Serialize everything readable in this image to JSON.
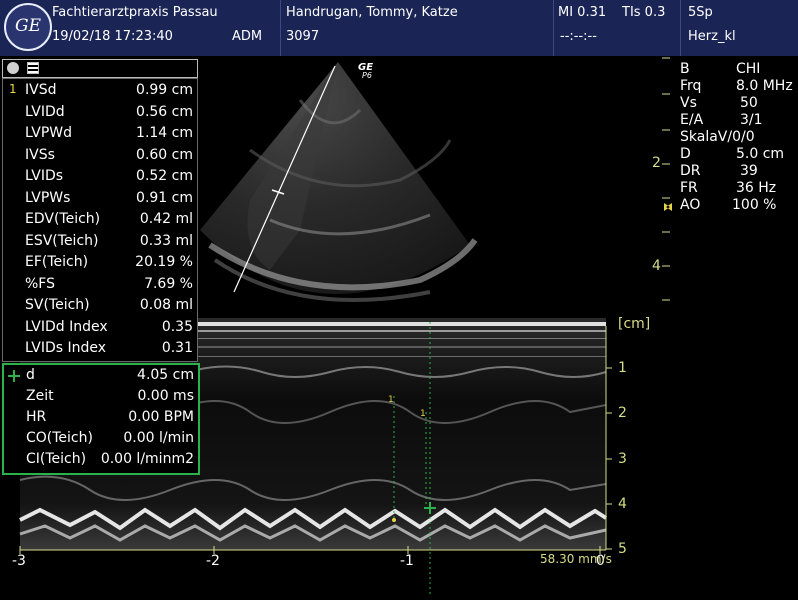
{
  "header": {
    "logo_text": "GE",
    "clinic": "Fachtierarztpraxis Passau",
    "datetime": "19/02/18 17:23:40",
    "operator": "ADM",
    "patient": "Handrugan, Tommy, Katze",
    "patient_id": "3097",
    "mi": "MI 0.31",
    "tis": "TIs 0.3",
    "time_placeholder": "--:--:--",
    "probe": "5Sp",
    "preset": "Herz_kl"
  },
  "probe_marker": {
    "brand": "GE",
    "code": "P6"
  },
  "measurements": [
    {
      "index": "1",
      "label": "IVSd",
      "value": "0.99 cm"
    },
    {
      "index": "",
      "label": "LVIDd",
      "value": "0.56 cm"
    },
    {
      "index": "",
      "label": "LVPWd",
      "value": "1.14 cm"
    },
    {
      "index": "",
      "label": "IVSs",
      "value": "0.60 cm"
    },
    {
      "index": "",
      "label": "LVIDs",
      "value": "0.52 cm"
    },
    {
      "index": "",
      "label": "LVPWs",
      "value": "0.91 cm"
    },
    {
      "index": "",
      "label": "EDV(Teich)",
      "value": "0.42 ml"
    },
    {
      "index": "",
      "label": "ESV(Teich)",
      "value": "0.33 ml"
    },
    {
      "index": "",
      "label": "EF(Teich)",
      "value": "20.19 %"
    },
    {
      "index": "",
      "label": "%FS",
      "value": "7.69 %"
    },
    {
      "index": "",
      "label": "SV(Teich)",
      "value": "0.08 ml"
    },
    {
      "index": "",
      "label": "LVIDd Index",
      "value": "0.35"
    },
    {
      "index": "",
      "label": "LVIDs Index",
      "value": "0.31"
    }
  ],
  "caliper_panel": [
    {
      "label": "d",
      "value": "4.05 cm"
    },
    {
      "label": "Zeit",
      "value": "0.00 ms"
    },
    {
      "label": "HR",
      "value": "0.00 BPM"
    },
    {
      "label": "CO(Teich)",
      "value": "0.00 l/min"
    },
    {
      "label": "CI(Teich)",
      "value": "0.00 l/minm2"
    }
  ],
  "params": [
    {
      "label": "B",
      "value": "CHI"
    },
    {
      "label": "Frq",
      "value": "8.0 MHz"
    },
    {
      "label": "Vs",
      "value": "50"
    },
    {
      "label": "E/A",
      "value": "3/1"
    },
    {
      "label": "SkalaV/0/0",
      "value": ""
    },
    {
      "label": "D",
      "value": "5.0 cm"
    },
    {
      "label": "DR",
      "value": "39"
    },
    {
      "label": "FR",
      "value": "36 Hz"
    },
    {
      "label": "AO",
      "value": "100 %"
    }
  ],
  "bmode_depth_ticks": [
    "2",
    "4"
  ],
  "mmode_unit": "[cm]",
  "mmode_depth_ticks": [
    "1",
    "2",
    "3",
    "4",
    "5"
  ],
  "time_ticks": [
    "-3",
    "-2",
    "-1",
    "0"
  ],
  "sweep_speed": "58.30 mm/s",
  "colors": {
    "header_bg": "#1a2455",
    "scale": "#d8dc88",
    "caliper": "#2cb24a",
    "marker": "#e8d44a"
  }
}
